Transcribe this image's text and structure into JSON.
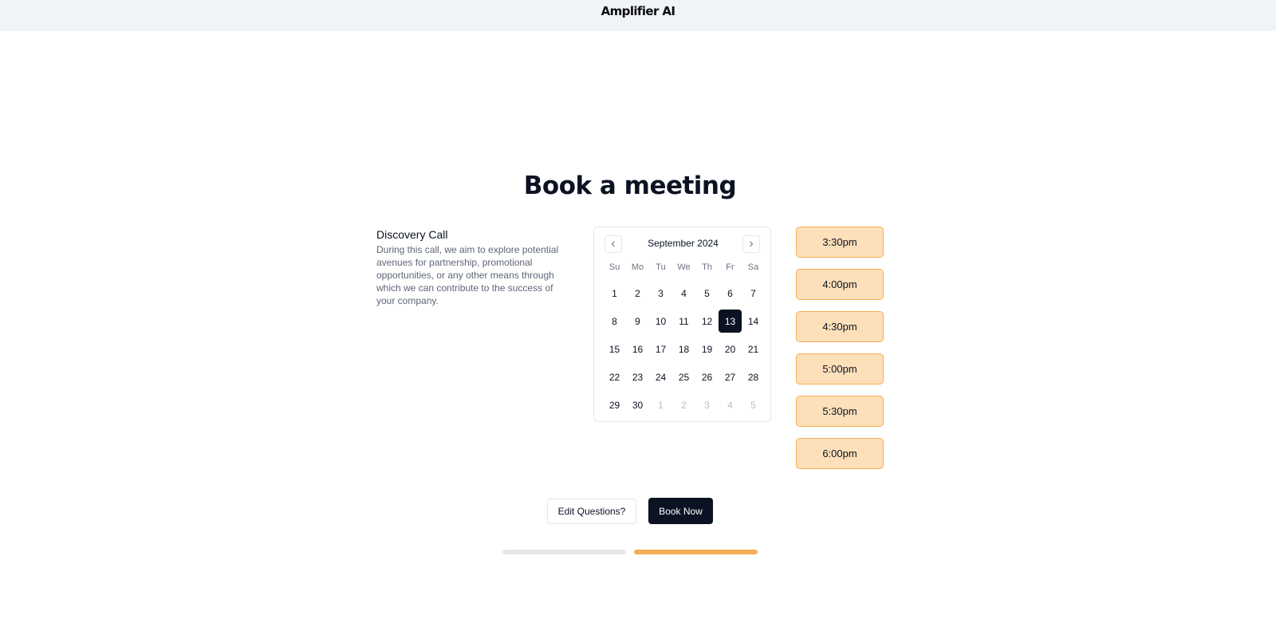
{
  "header": {
    "logo_text": "Amplifier AI"
  },
  "page": {
    "title": "Book a meeting"
  },
  "event": {
    "name": "Discovery Call",
    "description": "During this call, we aim to explore potential avenues for partnership, promotional opportunities, or any other means through which we can contribute to the success of your company."
  },
  "calendar": {
    "month_label": "September 2024",
    "weekdays": [
      "Su",
      "Mo",
      "Tu",
      "We",
      "Th",
      "Fr",
      "Sa"
    ],
    "days": [
      {
        "label": "1"
      },
      {
        "label": "2"
      },
      {
        "label": "3"
      },
      {
        "label": "4"
      },
      {
        "label": "5"
      },
      {
        "label": "6"
      },
      {
        "label": "7"
      },
      {
        "label": "8"
      },
      {
        "label": "9"
      },
      {
        "label": "10"
      },
      {
        "label": "11"
      },
      {
        "label": "12"
      },
      {
        "label": "13",
        "selected": true
      },
      {
        "label": "14"
      },
      {
        "label": "15"
      },
      {
        "label": "16"
      },
      {
        "label": "17"
      },
      {
        "label": "18"
      },
      {
        "label": "19"
      },
      {
        "label": "20"
      },
      {
        "label": "21"
      },
      {
        "label": "22"
      },
      {
        "label": "23"
      },
      {
        "label": "24"
      },
      {
        "label": "25"
      },
      {
        "label": "26"
      },
      {
        "label": "27"
      },
      {
        "label": "28"
      },
      {
        "label": "29"
      },
      {
        "label": "30"
      },
      {
        "label": "1",
        "muted": true
      },
      {
        "label": "2",
        "muted": true
      },
      {
        "label": "3",
        "muted": true
      },
      {
        "label": "4",
        "muted": true
      },
      {
        "label": "5",
        "muted": true
      }
    ],
    "prev_icon": "chevron-left-icon",
    "next_icon": "chevron-right-icon"
  },
  "time_slots": [
    "3:30pm",
    "4:00pm",
    "4:30pm",
    "5:00pm",
    "5:30pm",
    "6:00pm"
  ],
  "actions": {
    "edit_label": "Edit Questions?",
    "book_label": "Book Now"
  },
  "progress": {
    "total_steps": 2,
    "current_step": 2
  },
  "colors": {
    "primary": "#0b1222",
    "slot_fill": "#fde0b9",
    "slot_border": "#f6ad55",
    "progress_active": "#f6ad55",
    "progress_inactive": "#e5e7ea",
    "header_bg": "#f0f4f9"
  }
}
